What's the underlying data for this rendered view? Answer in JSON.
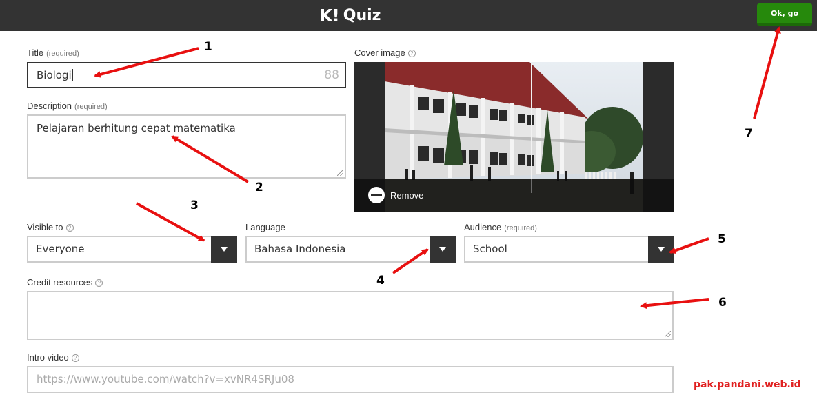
{
  "header": {
    "logo_mark": "K!",
    "logo_text": "Quiz",
    "ok_button": "Ok, go",
    "bar_color": "#333333",
    "ok_color": "#26890c"
  },
  "form": {
    "title": {
      "label": "Title",
      "required": "(required)",
      "value": "Biologi",
      "counter": "88"
    },
    "description": {
      "label": "Description",
      "required": "(required)",
      "value": "Pelajaran berhitung cepat matematika"
    },
    "cover_image": {
      "label": "Cover image",
      "help_icon": "question-circle-icon",
      "remove_label": "Remove",
      "remove_icon": "minus-circle-icon"
    },
    "visible_to": {
      "label": "Visible to",
      "value": "Everyone"
    },
    "language": {
      "label": "Language",
      "value": "Bahasa Indonesia"
    },
    "audience": {
      "label": "Audience",
      "required": "(required)",
      "value": "School"
    },
    "credit_resources": {
      "label": "Credit resources",
      "value": ""
    },
    "intro_video": {
      "label": "Intro video",
      "placeholder": "https://www.youtube.com/watch?v=xvNR4SRJu08"
    }
  },
  "annotations": {
    "numbers": [
      "1",
      "2",
      "3",
      "4",
      "5",
      "6",
      "7"
    ],
    "arrow_color": "#e81010",
    "watermark": "pak.pandani.web.id"
  }
}
